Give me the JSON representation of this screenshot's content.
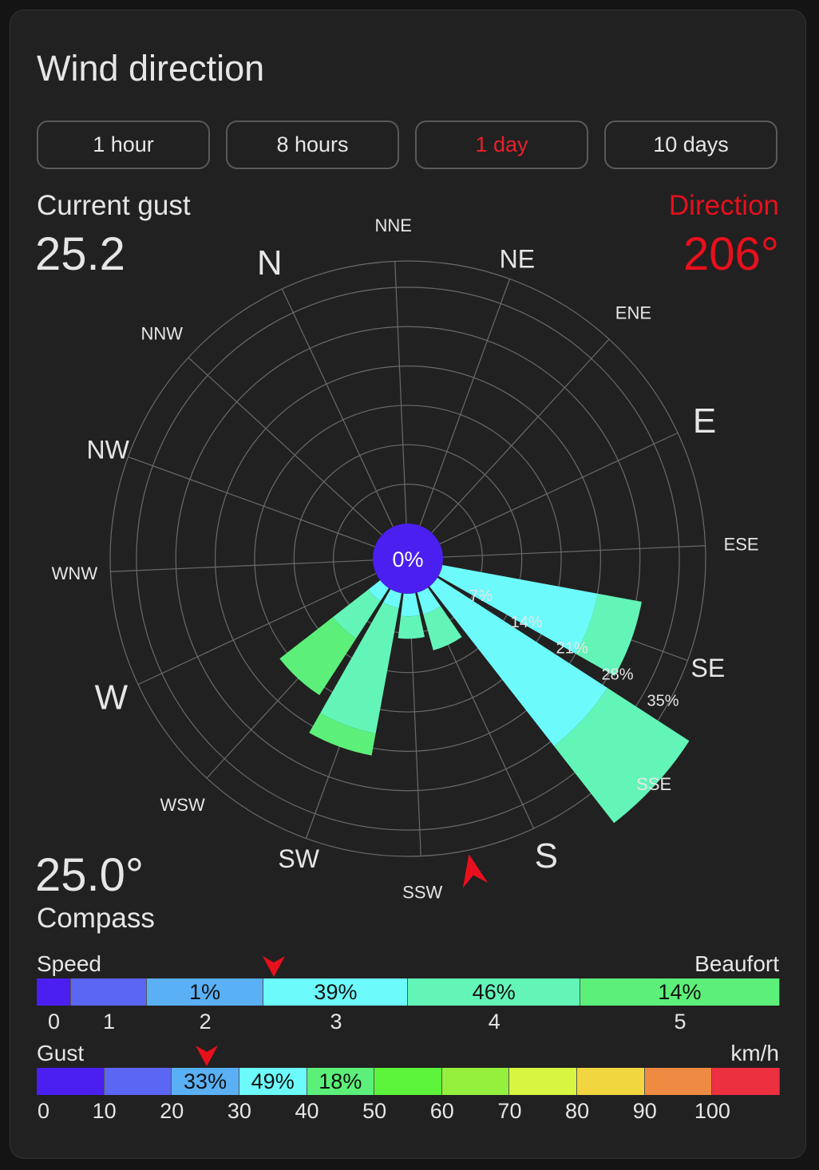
{
  "title": "Wind direction",
  "tabs": [
    {
      "label": "1 hour",
      "active": false
    },
    {
      "label": "8 hours",
      "active": false
    },
    {
      "label": "1 day",
      "active": true
    },
    {
      "label": "10 days",
      "active": false
    }
  ],
  "current_gust": {
    "label": "Current gust",
    "value": "25.2"
  },
  "direction": {
    "label": "Direction",
    "value": "206°"
  },
  "compass": {
    "label": "Compass",
    "value": "25.0°"
  },
  "colors": {
    "accent": "#e8101c",
    "center": "#4a1ff0"
  },
  "chart_data": {
    "type": "wind-rose",
    "rotation_deg": 25,
    "center_label": "0%",
    "ring_labels": [
      "7%",
      "14%",
      "21%",
      "28%",
      "35%"
    ],
    "ring_max": 35,
    "directions": [
      "N",
      "NNE",
      "NE",
      "ENE",
      "E",
      "ESE",
      "SE",
      "SSE",
      "S",
      "SSW",
      "SW",
      "WSW",
      "W",
      "WNW",
      "NW",
      "NNW"
    ],
    "petals": [
      {
        "direction": "SE",
        "segments": [
          {
            "to": 21,
            "color": "#6cfbfa"
          },
          {
            "to": 27,
            "color": "#63f5b8"
          }
        ]
      },
      {
        "direction": "SSE",
        "segments": [
          {
            "to": 27,
            "color": "#6cfbfa"
          },
          {
            "to": 40,
            "color": "#63f5b8"
          }
        ]
      },
      {
        "direction": "S",
        "segments": [
          {
            "to": 3,
            "color": "#6cfbfa"
          },
          {
            "to": 8,
            "color": "#63f5b8"
          }
        ]
      },
      {
        "direction": "SSW",
        "segments": [
          {
            "to": 3,
            "color": "#6cfbfa"
          },
          {
            "to": 6,
            "color": "#63f5b8"
          }
        ]
      },
      {
        "direction": "SW",
        "segments": [
          {
            "to": 2,
            "color": "#6cfbfa"
          },
          {
            "to": 19,
            "color": "#63f5b8"
          },
          {
            "to": 22,
            "color": "#5cf07a"
          }
        ]
      },
      {
        "direction": "WSW",
        "segments": [
          {
            "to": 2,
            "color": "#6cfbfa"
          },
          {
            "to": 8,
            "color": "#63f5b8"
          },
          {
            "to": 17,
            "color": "#5cf07a"
          }
        ]
      }
    ],
    "direction_marker": "SSW"
  },
  "speed_bar": {
    "left_label": "Speed",
    "right_label": "Beaufort",
    "marker_value": 3.45,
    "segments": [
      {
        "label": "",
        "color": "#4a1ff0",
        "start": 0,
        "end": 0.5
      },
      {
        "label": "",
        "color": "#5b66f2",
        "start": 0.5,
        "end": 1.6
      },
      {
        "label": "1%",
        "color": "#5ab0f4",
        "start": 1.6,
        "end": 3.3
      },
      {
        "label": "39%",
        "color": "#6cfbfa",
        "start": 3.3,
        "end": 5.4
      },
      {
        "label": "46%",
        "color": "#63f5b8",
        "start": 5.4,
        "end": 7.9
      },
      {
        "label": "14%",
        "color": "#5cf07a",
        "start": 7.9,
        "end": 10.8
      }
    ],
    "axis_max": 10.8,
    "ticks": [
      {
        "label": "0",
        "value": 0.25
      },
      {
        "label": "1",
        "value": 1.05
      },
      {
        "label": "2",
        "value": 2.45
      },
      {
        "label": "3",
        "value": 4.35
      },
      {
        "label": "4",
        "value": 6.65
      },
      {
        "label": "5",
        "value": 9.35
      }
    ]
  },
  "gust_bar": {
    "left_label": "Gust",
    "right_label": "km/h",
    "marker_value": 25.2,
    "segments": [
      {
        "label": "",
        "color": "#4a1ff0",
        "start": 0,
        "end": 10
      },
      {
        "label": "",
        "color": "#5b66f2",
        "start": 10,
        "end": 20
      },
      {
        "label": "33%",
        "color": "#5ab0f4",
        "start": 20,
        "end": 30
      },
      {
        "label": "49%",
        "color": "#6cfbfa",
        "start": 30,
        "end": 40
      },
      {
        "label": "18%",
        "color": "#5cf07a",
        "start": 40,
        "end": 50
      },
      {
        "label": "",
        "color": "#5cf43a",
        "start": 50,
        "end": 60
      },
      {
        "label": "",
        "color": "#95f03e",
        "start": 60,
        "end": 70
      },
      {
        "label": "",
        "color": "#d8f542",
        "start": 70,
        "end": 80
      },
      {
        "label": "",
        "color": "#f2d640",
        "start": 80,
        "end": 90
      },
      {
        "label": "",
        "color": "#ef8a42",
        "start": 90,
        "end": 100
      },
      {
        "label": "",
        "color": "#ec3040",
        "start": 100,
        "end": 110
      }
    ],
    "axis_max": 110,
    "ticks": [
      {
        "label": "0",
        "value": 1
      },
      {
        "label": "10",
        "value": 10
      },
      {
        "label": "20",
        "value": 20
      },
      {
        "label": "30",
        "value": 30
      },
      {
        "label": "40",
        "value": 40
      },
      {
        "label": "50",
        "value": 50
      },
      {
        "label": "60",
        "value": 60
      },
      {
        "label": "70",
        "value": 70
      },
      {
        "label": "80",
        "value": 80
      },
      {
        "label": "90",
        "value": 90
      },
      {
        "label": "100",
        "value": 100
      }
    ]
  }
}
